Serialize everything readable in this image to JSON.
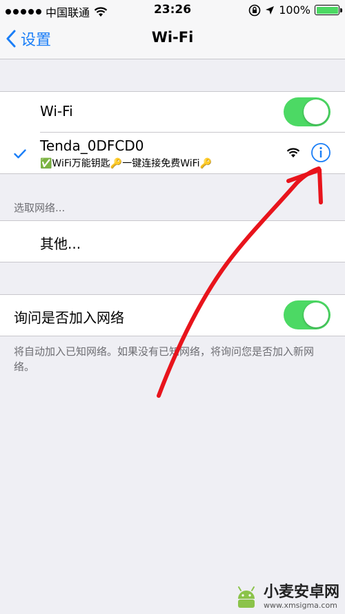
{
  "status_bar": {
    "carrier": "中国联通",
    "time": "23:26",
    "battery_percent": "100%",
    "battery_level": 1.0
  },
  "nav": {
    "back_label": "设置",
    "title": "Wi-Fi"
  },
  "wifi_group": {
    "wifi_label": "Wi-Fi",
    "wifi_on": true,
    "connected_network": {
      "name": "Tenda_0DFCD0",
      "subtitle": "✅WiFi万能钥匙🔑一键连接免费WiFi🔑"
    }
  },
  "choose_network": {
    "header": "选取网络...",
    "other_label": "其他..."
  },
  "ask_join": {
    "label": "询问是否加入网络",
    "on": true,
    "description": "将自动加入已知网络。如果没有已知网络，将询问您是否加入新网络。"
  },
  "watermark": {
    "name": "小麦安卓网",
    "url": "www.xmsigma.com"
  },
  "colors": {
    "accent": "#1a7ef7",
    "toggle_on": "#4cd964",
    "background": "#efeff4",
    "annotation": "#e8141c"
  },
  "icons": [
    "signal-dots-icon",
    "wifi-signal-icon",
    "rotation-lock-icon",
    "location-arrow-icon",
    "battery-icon",
    "back-chevron-icon",
    "checkmark-icon",
    "info-icon"
  ]
}
